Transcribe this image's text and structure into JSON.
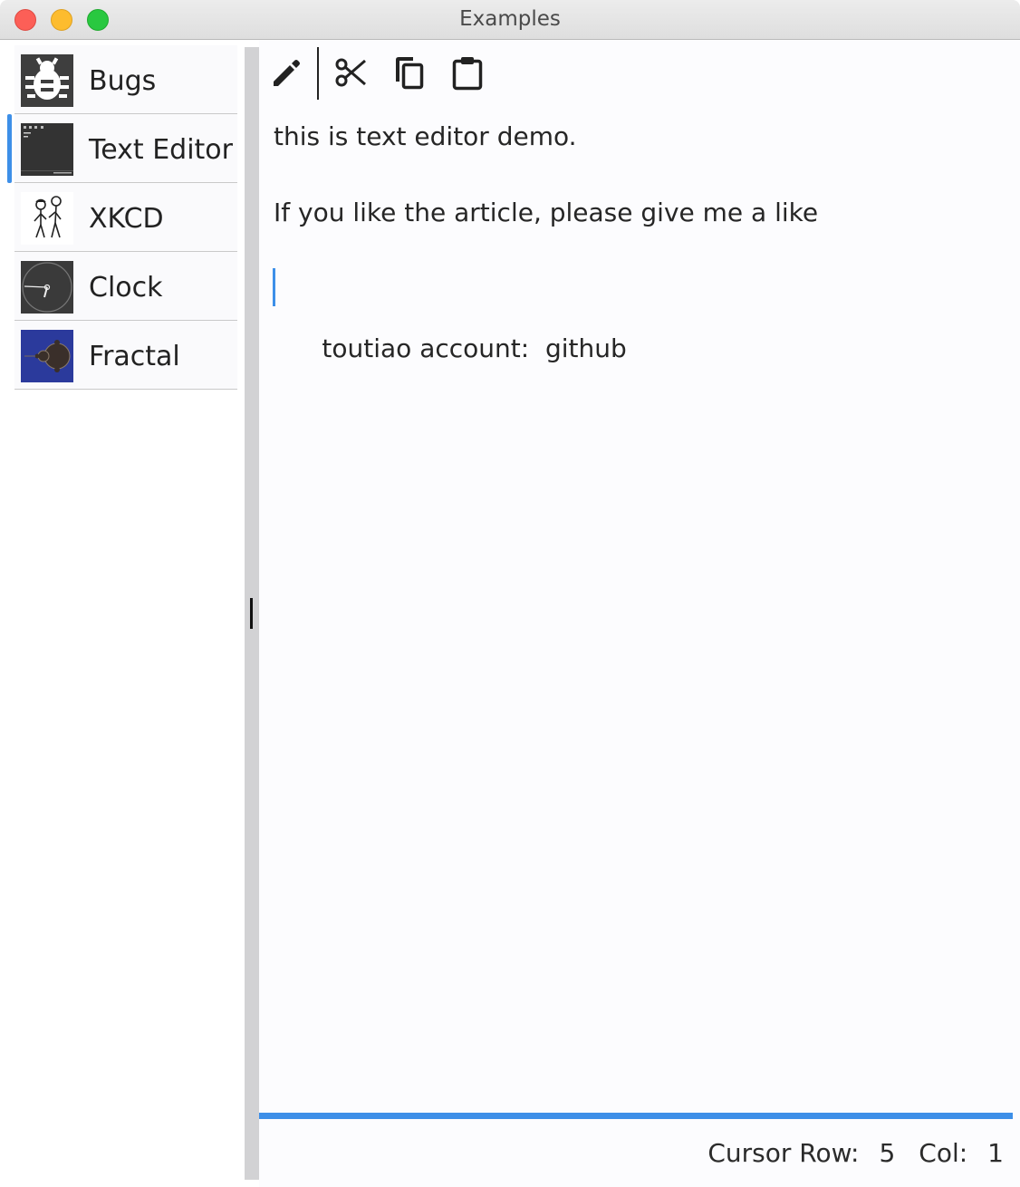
{
  "window": {
    "title": "Examples"
  },
  "sidebar": {
    "items": [
      {
        "label": "Bugs",
        "icon": "bug-icon",
        "selected": false
      },
      {
        "label": "Text Editor",
        "icon": "text-editor-thumbnail",
        "selected": true
      },
      {
        "label": "XKCD",
        "icon": "xkcd-thumbnail",
        "selected": false
      },
      {
        "label": "Clock",
        "icon": "clock-thumbnail",
        "selected": false
      },
      {
        "label": "Fractal",
        "icon": "fractal-thumbnail",
        "selected": false
      }
    ]
  },
  "toolbar": {
    "buttons": [
      {
        "icon": "pencil-icon"
      },
      {
        "icon": "scissors-icon"
      },
      {
        "icon": "copy-icon"
      },
      {
        "icon": "clipboard-icon"
      }
    ]
  },
  "editor": {
    "lines": [
      "this is text editor demo.",
      "If you like the article, please give me a like",
      "toutiao account:  github"
    ]
  },
  "status": {
    "row_label": "Cursor Row:",
    "row_value": "5",
    "col_label": "Col:",
    "col_value": "1"
  },
  "colors": {
    "accent": "#3d8fe8",
    "splitter": "#d2d2d4"
  }
}
